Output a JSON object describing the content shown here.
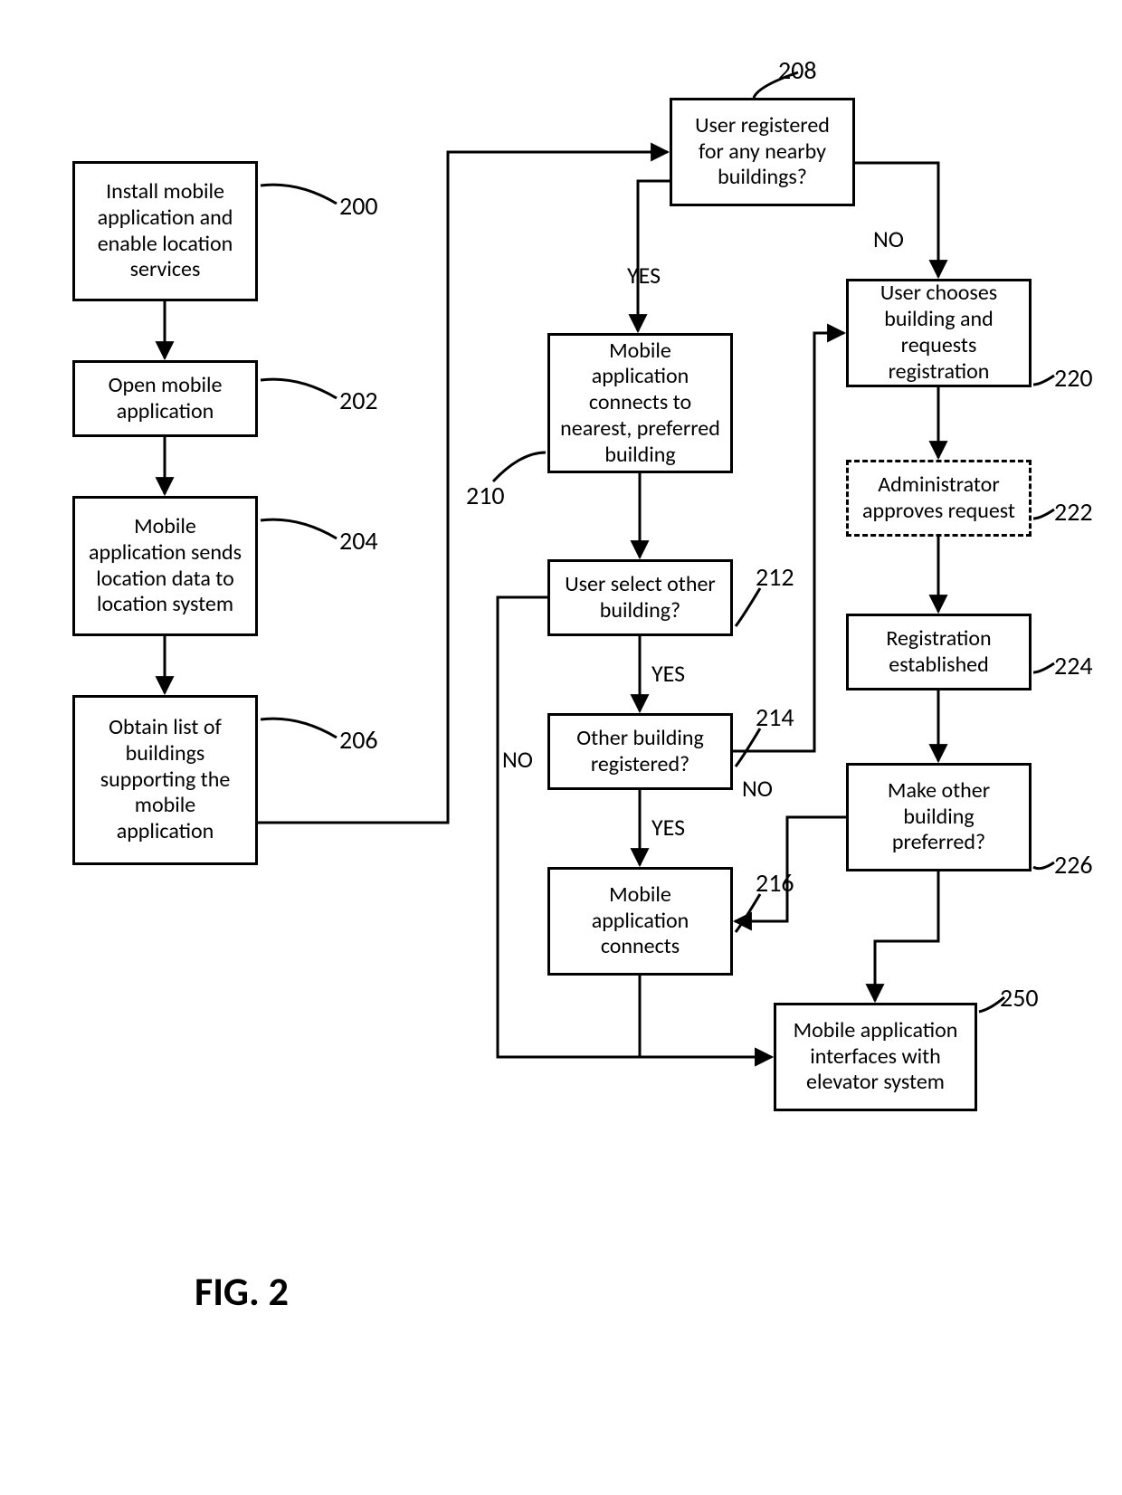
{
  "figure_label": "FIG. 2",
  "boxes": {
    "b200": "Install mobile application and enable location services",
    "b202": "Open mobile application",
    "b204": "Mobile application sends location data to location system",
    "b206": "Obtain list of buildings supporting the mobile application",
    "b208": "User registered for any nearby buildings?",
    "b210": "Mobile application connects to nearest, preferred building",
    "b212": "User select other building?",
    "b214": "Other building registered?",
    "b216": "Mobile application connects",
    "b220": "User chooses building and requests registration",
    "b222": "Administrator approves request",
    "b224": "Registration established",
    "b226": "Make other building preferred?",
    "b250": "Mobile application interfaces with elevator system"
  },
  "refs": {
    "r200": "200",
    "r202": "202",
    "r204": "204",
    "r206": "206",
    "r208": "208",
    "r210": "210",
    "r212": "212",
    "r214": "214",
    "r216": "216",
    "r220": "220",
    "r222": "222",
    "r224": "224",
    "r226": "226",
    "r250": "250"
  },
  "edges": {
    "yes208": "YES",
    "no208": "NO",
    "no212": "NO",
    "yes212": "YES",
    "no214": "NO",
    "yes214": "YES"
  }
}
